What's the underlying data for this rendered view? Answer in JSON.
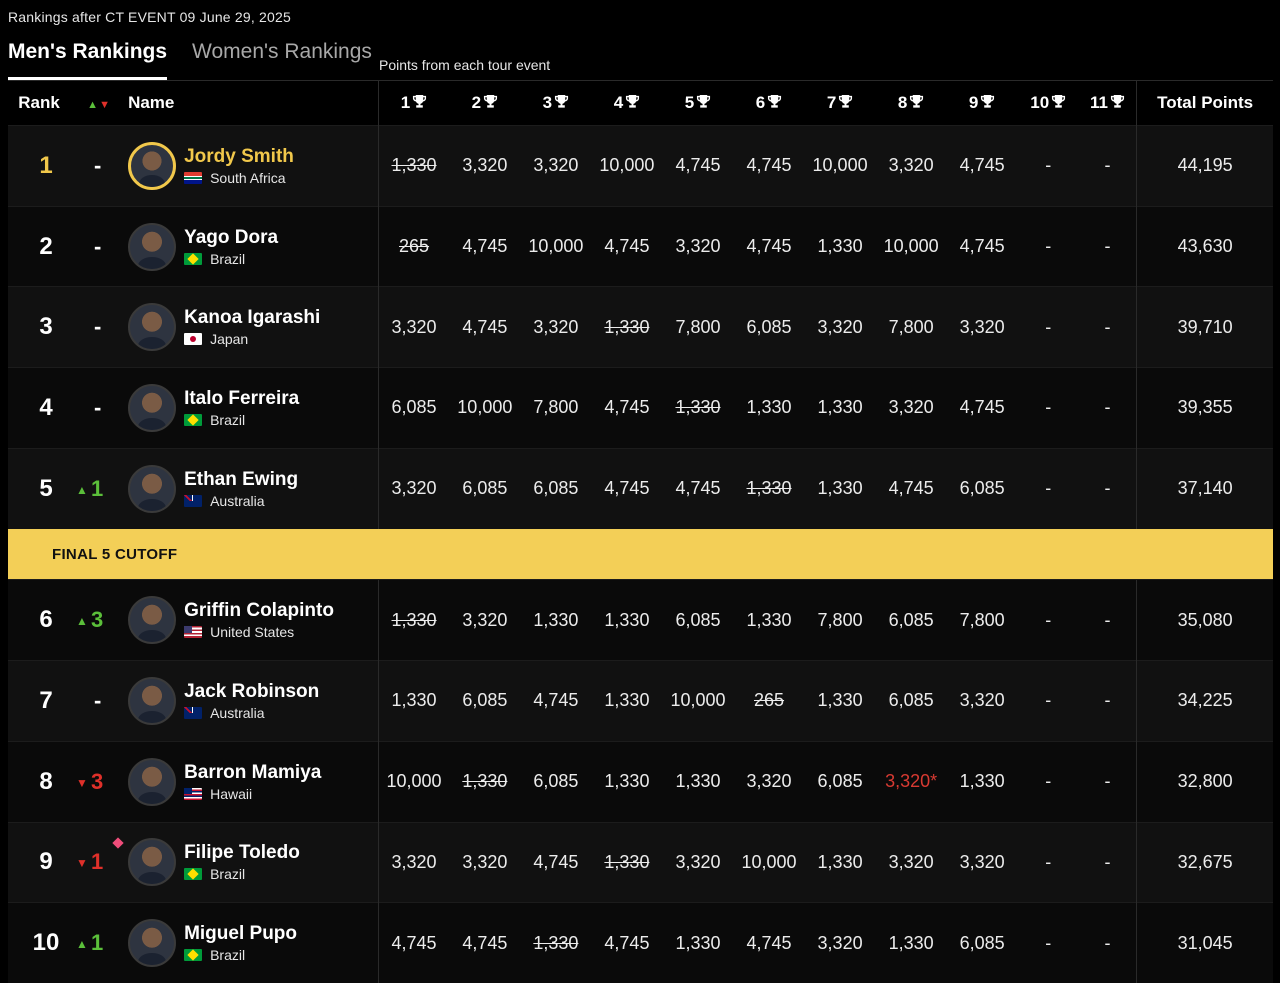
{
  "header": {
    "subtitle": "Rankings after CT EVENT 09 June 29, 2025",
    "tabs": [
      {
        "label": "Men's Rankings",
        "active": true
      },
      {
        "label": "Women's Rankings",
        "active": false
      }
    ],
    "points_note": "Points from each tour event"
  },
  "table": {
    "columns": {
      "rank": "Rank",
      "name": "Name",
      "events": [
        "1",
        "2",
        "3",
        "4",
        "5",
        "6",
        "7",
        "8",
        "9",
        "10",
        "11"
      ],
      "total": "Total Points"
    },
    "colors": {
      "leader": "#f1c84b",
      "up": "#5bbf3a",
      "down": "#e0302a",
      "cutoff": "#f3cf57",
      "injury": "#d83a32"
    },
    "cutoff_label": "FINAL 5 CUTOFF",
    "rows": [
      {
        "rank": "1",
        "change": "-",
        "dir": "none",
        "name": "Jordy Smith",
        "country": "South Africa",
        "flag": "za",
        "points": [
          "1,330",
          "3,320",
          "3,320",
          "10,000",
          "4,745",
          "4,745",
          "10,000",
          "3,320",
          "4,745",
          "-",
          "-"
        ],
        "dropped": [
          0
        ],
        "injury": [],
        "total": "44,195"
      },
      {
        "rank": "2",
        "change": "-",
        "dir": "none",
        "name": "Yago Dora",
        "country": "Brazil",
        "flag": "br",
        "points": [
          "265",
          "4,745",
          "10,000",
          "4,745",
          "3,320",
          "4,745",
          "1,330",
          "10,000",
          "4,745",
          "-",
          "-"
        ],
        "dropped": [
          0
        ],
        "injury": [],
        "total": "43,630"
      },
      {
        "rank": "3",
        "change": "-",
        "dir": "none",
        "name": "Kanoa Igarashi",
        "country": "Japan",
        "flag": "jp",
        "points": [
          "3,320",
          "4,745",
          "3,320",
          "1,330",
          "7,800",
          "6,085",
          "3,320",
          "7,800",
          "3,320",
          "-",
          "-"
        ],
        "dropped": [
          3
        ],
        "injury": [],
        "total": "39,710"
      },
      {
        "rank": "4",
        "change": "-",
        "dir": "none",
        "name": "Italo Ferreira",
        "country": "Brazil",
        "flag": "br",
        "points": [
          "6,085",
          "10,000",
          "7,800",
          "4,745",
          "1,330",
          "1,330",
          "1,330",
          "3,320",
          "4,745",
          "-",
          "-"
        ],
        "dropped": [
          4
        ],
        "injury": [],
        "total": "39,355"
      },
      {
        "rank": "5",
        "change": "1",
        "dir": "up",
        "name": "Ethan Ewing",
        "country": "Australia",
        "flag": "au",
        "points": [
          "3,320",
          "6,085",
          "6,085",
          "4,745",
          "4,745",
          "1,330",
          "1,330",
          "4,745",
          "6,085",
          "-",
          "-"
        ],
        "dropped": [
          5
        ],
        "injury": [],
        "total": "37,140"
      },
      {
        "rank": "6",
        "change": "3",
        "dir": "up",
        "name": "Griffin Colapinto",
        "country": "United States",
        "flag": "us",
        "points": [
          "1,330",
          "3,320",
          "1,330",
          "1,330",
          "6,085",
          "1,330",
          "7,800",
          "6,085",
          "7,800",
          "-",
          "-"
        ],
        "dropped": [
          0
        ],
        "injury": [],
        "total": "35,080"
      },
      {
        "rank": "7",
        "change": "-",
        "dir": "none",
        "name": "Jack Robinson",
        "country": "Australia",
        "flag": "au",
        "points": [
          "1,330",
          "6,085",
          "4,745",
          "1,330",
          "10,000",
          "265",
          "1,330",
          "6,085",
          "3,320",
          "-",
          "-"
        ],
        "dropped": [
          5
        ],
        "injury": [],
        "total": "34,225"
      },
      {
        "rank": "8",
        "change": "3",
        "dir": "down",
        "name": "Barron Mamiya",
        "country": "Hawaii",
        "flag": "hi",
        "points": [
          "10,000",
          "1,330",
          "6,085",
          "1,330",
          "1,330",
          "3,320",
          "6,085",
          "3,320*",
          "1,330",
          "-",
          "-"
        ],
        "dropped": [
          1
        ],
        "injury": [
          7
        ],
        "total": "32,800"
      },
      {
        "rank": "9",
        "change": "1",
        "dir": "down",
        "name": "Filipe Toledo",
        "country": "Brazil",
        "flag": "br",
        "points": [
          "3,320",
          "3,320",
          "4,745",
          "1,330",
          "3,320",
          "10,000",
          "1,330",
          "3,320",
          "3,320",
          "-",
          "-"
        ],
        "dropped": [
          3
        ],
        "injury": [],
        "total": "32,675",
        "diamond": true
      },
      {
        "rank": "10",
        "change": "1",
        "dir": "up",
        "name": "Miguel Pupo",
        "country": "Brazil",
        "flag": "br",
        "points": [
          "4,745",
          "4,745",
          "1,330",
          "4,745",
          "1,330",
          "4,745",
          "3,320",
          "1,330",
          "6,085",
          "-",
          "-"
        ],
        "dropped": [
          2
        ],
        "injury": [],
        "total": "31,045"
      }
    ]
  }
}
